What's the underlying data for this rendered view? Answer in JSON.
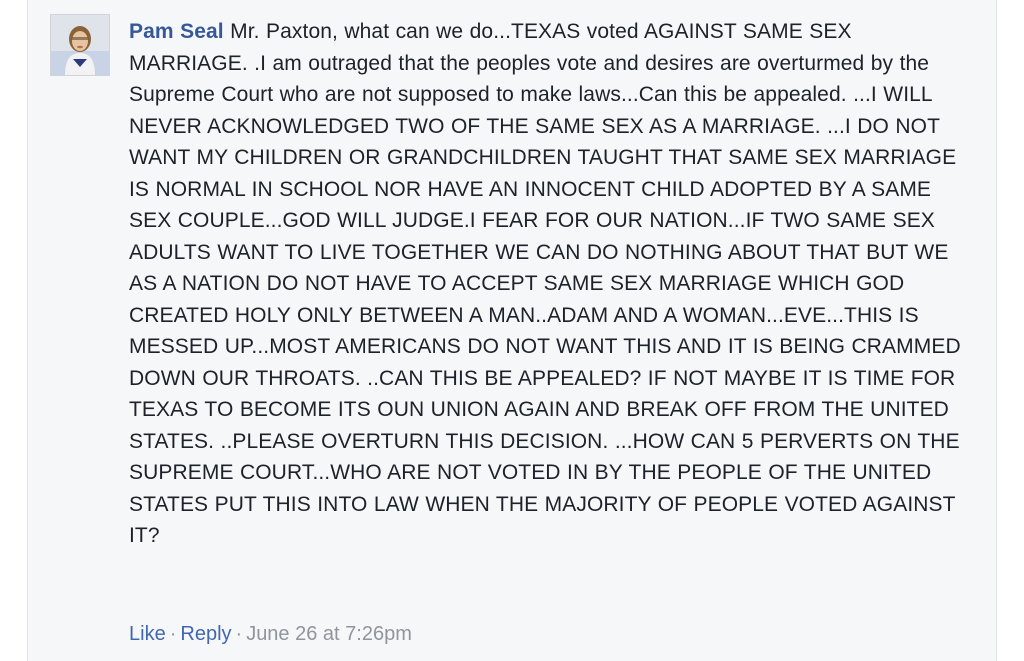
{
  "comment": {
    "author": "Pam Seal",
    "text": "Mr. Paxton, what can we do...TEXAS voted AGAINST SAME SEX MARRIAGE. .I am outraged that the peoples vote and desires are overturmed by the Supreme Court who are not supposed to make laws...Can this be appealed. ...I WILL NEVER ACKNOWLEDGED TWO OF THE SAME SEX AS A MARRIAGE. ...I DO NOT WANT MY CHILDREN OR GRANDCHILDREN TAUGHT THAT SAME SEX MARRIAGE IS NORMAL IN SCHOOL NOR HAVE AN INNOCENT CHILD ADOPTED BY A SAME SEX COUPLE...GOD WILL JUDGE.I FEAR FOR OUR NATION...IF TWO SAME SEX ADULTS WANT TO LIVE TOGETHER WE CAN DO NOTHING ABOUT THAT BUT WE AS A NATION DO NOT HAVE TO ACCEPT SAME SEX MARRIAGE WHICH GOD CREATED HOLY ONLY BETWEEN A MAN..ADAM AND A WOMAN...EVE...THIS IS MESSED UP...MOST AMERICANS DO NOT WANT THIS AND IT IS BEING CRAMMED DOWN OUR THROATS. ..CAN THIS BE APPEALED? IF NOT MAYBE IT IS TIME FOR TEXAS TO BECOME ITS OUN UNION AGAIN AND BREAK OFF FROM THE UNITED STATES. ..PLEASE OVERTURN THIS DECISION. ...HOW CAN 5 PERVERTS ON THE SUPREME COURT...WHO ARE NOT VOTED IN BY THE PEOPLE OF THE UNITED STATES PUT THIS INTO LAW WHEN THE MAJORITY OF PEOPLE VOTED AGAINST IT?"
  },
  "actions": {
    "like_label": "Like",
    "reply_label": "Reply",
    "separator": "·",
    "timestamp": "June 26 at 7:26pm"
  },
  "colors": {
    "author_link": "#365899",
    "action_link": "#4267b2",
    "meta_text": "#90949c",
    "card_background": "#f6f7f9"
  }
}
